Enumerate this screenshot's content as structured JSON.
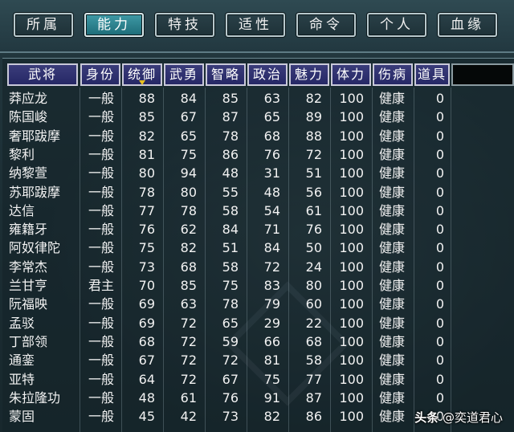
{
  "tabs": [
    {
      "label": "所属",
      "active": false
    },
    {
      "label": "能力",
      "active": true
    },
    {
      "label": "特技",
      "active": false
    },
    {
      "label": "适性",
      "active": false
    },
    {
      "label": "命令",
      "active": false
    },
    {
      "label": "个人",
      "active": false
    },
    {
      "label": "血缘",
      "active": false
    }
  ],
  "columns": [
    "武将",
    "身份",
    "统御",
    "武勇",
    "智略",
    "政治",
    "魅力",
    "体力",
    "伤病",
    "道具"
  ],
  "sort_column": "统御",
  "rows": [
    {
      "name": "莽应龙",
      "status": "一般",
      "tongyu": "88",
      "wuyong": "84",
      "zhilue": "85",
      "zhengzhi": "63",
      "meili": "82",
      "tili": "100",
      "shangbing": "健康",
      "daoju": "0"
    },
    {
      "name": "陈国峻",
      "status": "一般",
      "tongyu": "85",
      "wuyong": "67",
      "zhilue": "87",
      "zhengzhi": "65",
      "meili": "89",
      "tili": "100",
      "shangbing": "健康",
      "daoju": "0"
    },
    {
      "name": "奢耶跋摩",
      "status": "一般",
      "tongyu": "82",
      "wuyong": "65",
      "zhilue": "78",
      "zhengzhi": "68",
      "meili": "88",
      "tili": "100",
      "shangbing": "健康",
      "daoju": "0"
    },
    {
      "name": "黎利",
      "status": "一般",
      "tongyu": "81",
      "wuyong": "75",
      "zhilue": "86",
      "zhengzhi": "76",
      "meili": "72",
      "tili": "100",
      "shangbing": "健康",
      "daoju": "0"
    },
    {
      "name": "纳黎萱",
      "status": "一般",
      "tongyu": "80",
      "wuyong": "94",
      "zhilue": "48",
      "zhengzhi": "31",
      "meili": "51",
      "tili": "100",
      "shangbing": "健康",
      "daoju": "0"
    },
    {
      "name": "苏耶跋摩",
      "status": "一般",
      "tongyu": "78",
      "wuyong": "80",
      "zhilue": "55",
      "zhengzhi": "48",
      "meili": "56",
      "tili": "100",
      "shangbing": "健康",
      "daoju": "0"
    },
    {
      "name": "达信",
      "status": "一般",
      "tongyu": "77",
      "wuyong": "78",
      "zhilue": "58",
      "zhengzhi": "54",
      "meili": "61",
      "tili": "100",
      "shangbing": "健康",
      "daoju": "0"
    },
    {
      "name": "雍籍牙",
      "status": "一般",
      "tongyu": "76",
      "wuyong": "62",
      "zhilue": "84",
      "zhengzhi": "71",
      "meili": "76",
      "tili": "100",
      "shangbing": "健康",
      "daoju": "0"
    },
    {
      "name": "阿奴律陀",
      "status": "一般",
      "tongyu": "75",
      "wuyong": "82",
      "zhilue": "51",
      "zhengzhi": "84",
      "meili": "50",
      "tili": "100",
      "shangbing": "健康",
      "daoju": "0"
    },
    {
      "name": "李常杰",
      "status": "一般",
      "tongyu": "73",
      "wuyong": "68",
      "zhilue": "58",
      "zhengzhi": "72",
      "meili": "24",
      "tili": "100",
      "shangbing": "健康",
      "daoju": "0"
    },
    {
      "name": "兰甘亨",
      "status": "君主",
      "tongyu": "70",
      "wuyong": "85",
      "zhilue": "75",
      "zhengzhi": "83",
      "meili": "80",
      "tili": "100",
      "shangbing": "健康",
      "daoju": "0"
    },
    {
      "name": "阮福映",
      "status": "一般",
      "tongyu": "69",
      "wuyong": "63",
      "zhilue": "78",
      "zhengzhi": "79",
      "meili": "60",
      "tili": "100",
      "shangbing": "健康",
      "daoju": "0"
    },
    {
      "name": "孟驳",
      "status": "一般",
      "tongyu": "69",
      "wuyong": "72",
      "zhilue": "65",
      "zhengzhi": "29",
      "meili": "22",
      "tili": "100",
      "shangbing": "健康",
      "daoju": "0"
    },
    {
      "name": "丁部领",
      "status": "一般",
      "tongyu": "68",
      "wuyong": "72",
      "zhilue": "59",
      "zhengzhi": "66",
      "meili": "68",
      "tili": "100",
      "shangbing": "健康",
      "daoju": "0"
    },
    {
      "name": "通銮",
      "status": "一般",
      "tongyu": "67",
      "wuyong": "72",
      "zhilue": "72",
      "zhengzhi": "81",
      "meili": "58",
      "tili": "100",
      "shangbing": "健康",
      "daoju": "0"
    },
    {
      "name": "亚特",
      "status": "一般",
      "tongyu": "64",
      "wuyong": "72",
      "zhilue": "67",
      "zhengzhi": "75",
      "meili": "77",
      "tili": "100",
      "shangbing": "健康",
      "daoju": "0"
    },
    {
      "name": "朱拉隆功",
      "status": "一般",
      "tongyu": "48",
      "wuyong": "61",
      "zhilue": "76",
      "zhengzhi": "91",
      "meili": "87",
      "tili": "100",
      "shangbing": "健康",
      "daoju": "0"
    },
    {
      "name": "蒙固",
      "status": "一般",
      "tongyu": "45",
      "wuyong": "42",
      "zhilue": "73",
      "zhengzhi": "82",
      "meili": "86",
      "tili": "100",
      "shangbing": "健康",
      "daoju": "0"
    }
  ],
  "watermark": {
    "prefix": "头条",
    "handle": "@奕道君心"
  }
}
